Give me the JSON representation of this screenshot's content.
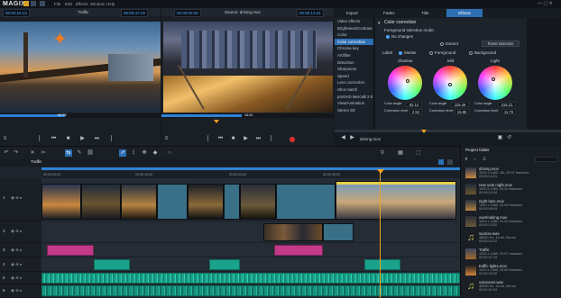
{
  "app": {
    "logo": "MAGIX",
    "menu": [
      "File",
      "Edit",
      "Effects",
      "Window",
      "Help"
    ]
  },
  "source_monitor": {
    "clip_name": "Traffic",
    "timecode_left": "00:00:16:13",
    "timecode_right": "00:00:47:19",
    "duration": "00:29"
  },
  "program_monitor": {
    "timecode_left": "00:00:00:00",
    "title": "Source: driving.mov",
    "timecode_right": "00:00:14:21",
    "duration": "14:21"
  },
  "effects_tabs": [
    "Import",
    "Fades",
    "Title",
    "Effects"
  ],
  "effects_active_tab": "Effects",
  "video_effects": {
    "items": [
      "Video effects",
      "Brightness/Contrast",
      "Color",
      "Color correction",
      "Chroma key",
      "Artifilter",
      "Distortion",
      "Sharpness",
      "Speed",
      "Lens correction",
      "Shot match",
      "proDAD Mercalli 2.0",
      "View/Animation",
      "Stereo 3D"
    ],
    "selected": "Color correction"
  },
  "color_correction": {
    "title": "Color correction",
    "mode_label": "Foreground selection mode",
    "no_changes": "No changes",
    "extract": "Extract",
    "reset_selection": "Reset selection",
    "label": "Label",
    "master": "Master",
    "foreground": "Foreground",
    "background": "Background",
    "wheels": [
      {
        "name": "Shadow",
        "angle_label": "Color angle",
        "angle": "52.12",
        "level_label": "Correction level",
        "level": "2.52"
      },
      {
        "name": "Mid",
        "angle_label": "Color angle",
        "angle": "119.49",
        "level_label": "Correction level",
        "level": "15.85"
      },
      {
        "name": "Light",
        "angle_label": "Color angle",
        "angle": "215.21",
        "level_label": "Correction level",
        "level": "11.70"
      }
    ]
  },
  "effects_footer": {
    "file": "driving.mov"
  },
  "timeline": {
    "tab": "Traffic",
    "ruler": [
      "00:00:00:00",
      "00:00:10:00",
      "00:00:20:00",
      "00:00:30:00"
    ],
    "tracks": [
      "1",
      "2",
      "3",
      "4",
      "5",
      "6"
    ]
  },
  "project_folder": {
    "title": "Project folder",
    "items": [
      {
        "name": "driving.mov",
        "meta": [
          "1920 x 1080, 30i, 29.97 frames/s",
          "00:00:14:21"
        ]
      },
      {
        "name": "new york night.mov",
        "meta": [
          "1920 x 1080, 25.00 frames/s",
          "00:00:19:04"
        ]
      },
      {
        "name": "night lane.mov",
        "meta": [
          "1920 x 1080, 25.00 frames/s",
          "00:00:08:09"
        ]
      },
      {
        "name": "overlooking.mov",
        "meta": [
          "1920 x 1080, 24.00 frames/s",
          "00:00:13:20"
        ]
      },
      {
        "name": "sunrise.wav",
        "meta": [
          "48000 Hz, 16 bit, Stereo",
          "00:00:15:22"
        ]
      },
      {
        "name": "Traffic",
        "meta": [
          "1920 x 1080, 29.97 frames/s",
          "00:00:47:19"
        ]
      },
      {
        "name": "traffic lights.mov",
        "meta": [
          "1920 x 1080, 25.00 frames/s",
          "00:00:18:02"
        ]
      },
      {
        "name": "voiceover.wav",
        "meta": [
          "48000 Hz, 16 bit, Stereo",
          "00:00:21:04"
        ]
      }
    ]
  },
  "colors": {
    "accent": "#2d6fb3",
    "timecode": "#4da3ff",
    "audio_clip": "#1aa38c",
    "title_clip": "#c23a88",
    "playhead": "#f0a020"
  }
}
